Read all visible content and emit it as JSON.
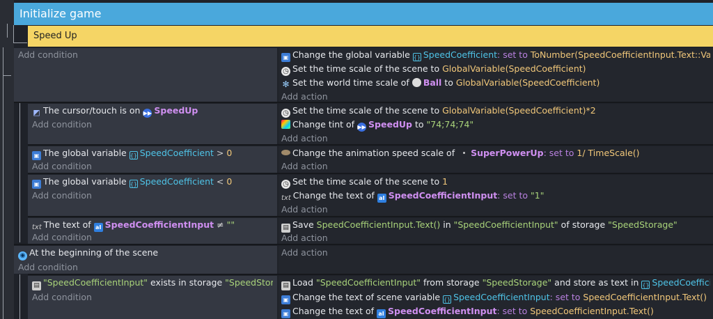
{
  "group": {
    "title": "Initialize game"
  },
  "subgroup": {
    "title": "Speed Up"
  },
  "ui": {
    "add_condition": "Add condition",
    "add_action": "Add action"
  },
  "events": {
    "e1": {
      "a1": {
        "t1": "Change the global variable",
        "var": "SpeedCoefficient",
        "t2": ": set to",
        "val": "ToNumber(SpeedCoefficientInput.Text::Value())"
      },
      "a2": {
        "t1": "Set the time scale of the scene to",
        "val": "GlobalVariable(SpeedCoefficient)"
      },
      "a3": {
        "t1": "Set the world time scale of",
        "obj": "Ball",
        "t2": "to",
        "val": "GlobalVariable(SpeedCoefficient)"
      }
    },
    "e2": {
      "c1": {
        "t1": "The cursor/touch is on",
        "obj": "SpeedUp"
      },
      "a1": {
        "t1": "Set the time scale of the scene to",
        "val": "GlobalVariable(SpeedCoefficient)*2"
      },
      "a2": {
        "t1": "Change tint of",
        "obj": "SpeedUp",
        "t2": "to",
        "val": "\"74;74;74\""
      }
    },
    "e3": {
      "c1": {
        "t1": "The global variable",
        "var": "SpeedCoefficient",
        "op": ">",
        "val": "0"
      },
      "a1": {
        "t1": "Change the animation speed scale of",
        "obj": "SuperPowerUp",
        "t2": ": set to",
        "val": "1/ TimeScale()"
      }
    },
    "e4": {
      "c1": {
        "t1": "The global variable",
        "var": "SpeedCoefficient",
        "op": "<",
        "val": "0"
      },
      "a1": {
        "t1": "Set the time scale of the scene to",
        "val": "1"
      },
      "a2": {
        "t1": "Change the text of",
        "obj": "SpeedCoefficientInput",
        "t2": ": set to",
        "val": "\"1\""
      }
    },
    "e5": {
      "c1": {
        "t1": "The text of",
        "obj": "SpeedCoefficientInput",
        "op": "≠",
        "val": "\"\""
      },
      "a1": {
        "t1": "Save",
        "val": "SpeedCoefficientInput.Text()",
        "t2": "in",
        "str1": "\"SpeedCoefficientInput\"",
        "t3": "of storage",
        "str2": "\"SpeedStorage\""
      }
    },
    "e6": {
      "c1": {
        "t1": "At the beginning of the scene"
      }
    },
    "e7": {
      "c1": {
        "str1": "\"SpeedCoefficientInput\"",
        "t1": "exists in storage",
        "str2": "\"SpeedStorage\""
      },
      "a1": {
        "t1": "Load",
        "str1": "\"SpeedCoefficientInput\"",
        "t2": "from storage",
        "str2": "\"SpeedStorage\"",
        "t3": "and store as text in",
        "var": "SpeedCoefficientInput"
      },
      "a2": {
        "t1": "Change the text of scene variable",
        "var": "SpeedCoefficientInput",
        "t2": ": set to",
        "val": "SpeedCoefficientInput.Text()"
      },
      "a3": {
        "t1": "Change the text of",
        "obj": "SpeedCoefficientInput",
        "t2": ": set to",
        "val": "SpeedCoefficientInput.Text()"
      }
    }
  }
}
